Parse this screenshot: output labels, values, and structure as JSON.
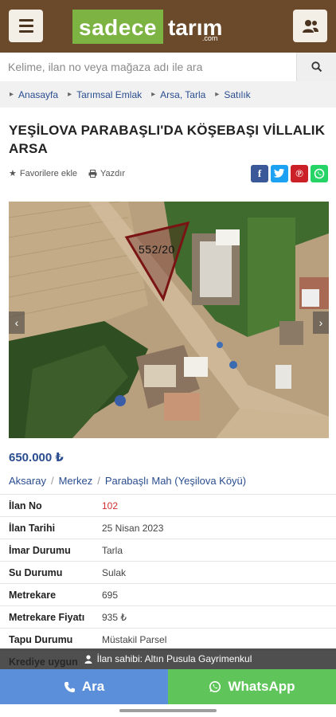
{
  "header": {
    "logo_left": "sadece",
    "logo_right": "tarım",
    "logo_suffix": ".com"
  },
  "search": {
    "placeholder": "Kelime, ilan no veya mağaza adı ile ara"
  },
  "breadcrumb": [
    "Anasayfa",
    "Tarımsal Emlak",
    "Arsa, Tarla",
    "Satılık"
  ],
  "listing": {
    "title": "YEŞİLOVA PARABAŞLI'DA KÖŞEBAŞI VİLLALIK ARSA",
    "favorite_label": "Favorilere ekle",
    "print_label": "Yazdır",
    "photo_overlay_text": "552/20",
    "price": "650.000 ₺",
    "location": [
      "Aksaray",
      "Merkez",
      "Parabaşlı Mah (Yeşilova Köyü)"
    ],
    "details": [
      {
        "key": "İlan No",
        "value": "102"
      },
      {
        "key": "İlan Tarihi",
        "value": "25 Nisan 2023"
      },
      {
        "key": "İmar Durumu",
        "value": "Tarla"
      },
      {
        "key": "Su Durumu",
        "value": "Sulak"
      },
      {
        "key": "Metrekare",
        "value": "695"
      },
      {
        "key": "Metrekare Fiyatı",
        "value": "935 ₺"
      },
      {
        "key": "Tapu Durumu",
        "value": "Müstakil Parsel"
      },
      {
        "key": "Krediye uygun",
        "value": ""
      }
    ]
  },
  "owner_bar": "İlan sahibi: Altın Pusula Gayrimenkul",
  "buttons": {
    "call": "Ara",
    "whatsapp": "WhatsApp"
  },
  "colors": {
    "header": "#6b4a2b",
    "logo_green": "#7cb342",
    "link_blue": "#2a4d8f",
    "call_blue": "#5b8fd9",
    "whatsapp_green": "#5fc45a",
    "facebook": "#3b5998",
    "twitter": "#1da1f2",
    "pinterest": "#cb2027",
    "whatsapp_share": "#25d366"
  },
  "icons": {
    "menu": "hamburger-icon",
    "user": "users-icon",
    "search": "search-icon",
    "favorite": "star-icon",
    "print": "printer-icon",
    "share": [
      "facebook-icon",
      "twitter-icon",
      "pinterest-icon",
      "whatsapp-icon"
    ],
    "owner": "user-icon",
    "call": "phone-icon",
    "whatsapp": "whatsapp-icon"
  }
}
